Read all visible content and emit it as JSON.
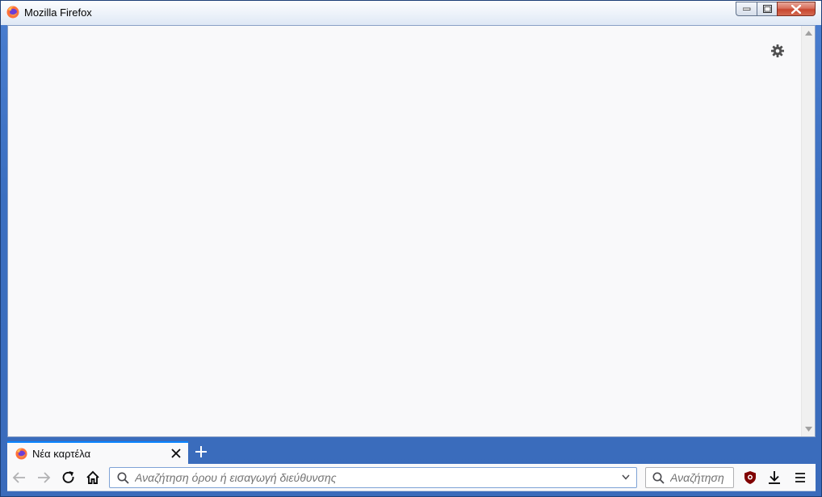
{
  "window": {
    "title": "Mozilla Firefox",
    "controls": [
      "minimize-icon",
      "maximize-icon",
      "close-icon"
    ]
  },
  "tabs": [
    {
      "label": "Νέα καρτέλα",
      "icon": "firefox-icon",
      "active": true
    }
  ],
  "toolbar": {
    "url_placeholder": "Αναζήτηση όρου ή εισαγωγή διεύθυνσης",
    "search_placeholder": "Αναζήτηση",
    "icons": [
      "back-icon",
      "forward-icon",
      "reload-icon",
      "home-icon",
      "ublock-icon",
      "download-icon",
      "menu-icon"
    ]
  },
  "colors": {
    "accent": "#0a84ff",
    "frame": "#3b6fc0",
    "content_bg": "#f9f9fa"
  }
}
